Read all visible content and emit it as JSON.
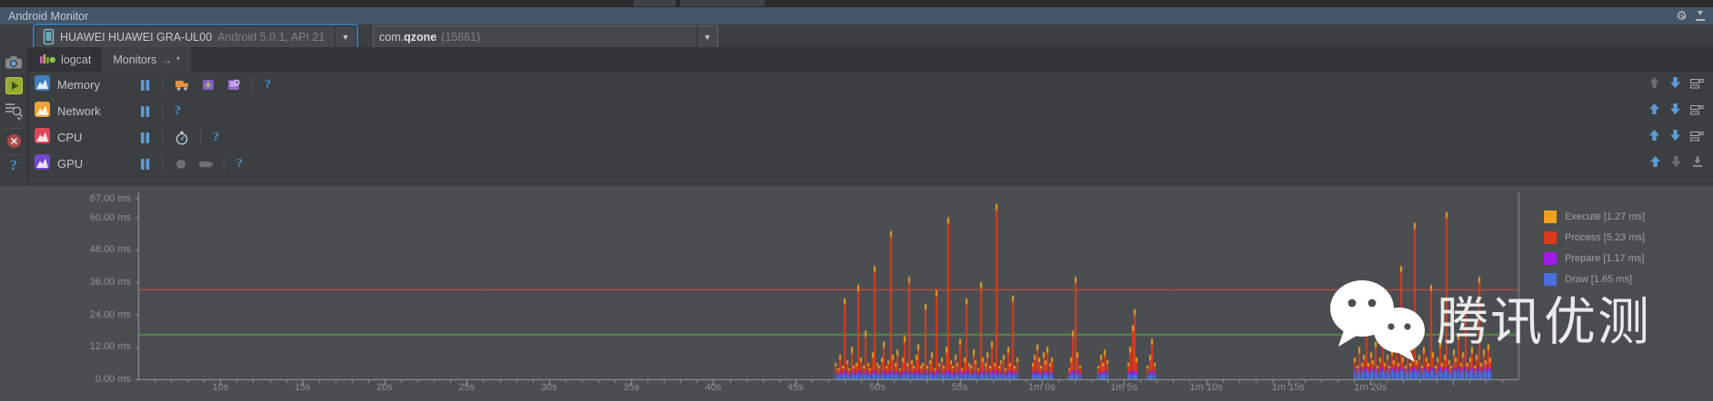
{
  "title_bar": {
    "title": "Android Monitor"
  },
  "toolbar": {
    "device": {
      "name": "HUAWEI HUAWEI GRA-UL00",
      "details": "Android 5.0.1, API 21"
    },
    "process": {
      "prefix": "com.",
      "name": "qzone",
      "pid": "(15861)"
    }
  },
  "tabs": [
    {
      "label": "logcat",
      "selected": false
    },
    {
      "label": "Monitors",
      "selected": true,
      "suffix": "→",
      "star": "*"
    }
  ],
  "monitors": [
    {
      "label": "Memory",
      "icon_color": "#3f7fc1",
      "tools": [
        "pause",
        "sep",
        "gc-truck",
        "heap-dump",
        "alloc-tracker",
        "sep",
        "help"
      ],
      "right": {
        "up": false,
        "down": true,
        "last": "restore"
      }
    },
    {
      "label": "Network",
      "icon_color": "#f0a232",
      "tools": [
        "pause",
        "sep",
        "help"
      ],
      "right": {
        "up": true,
        "down": true,
        "last": "restore"
      }
    },
    {
      "label": "CPU",
      "icon_color": "#e0495a",
      "tools": [
        "pause",
        "sep",
        "stopwatch",
        "sep",
        "help"
      ],
      "right": {
        "up": true,
        "down": true,
        "last": "restore"
      }
    },
    {
      "label": "GPU",
      "icon_color": "#7148ce",
      "tools": [
        "pause",
        "sep",
        "record-circle",
        "record-pill",
        "sep",
        "help-dim"
      ],
      "right": {
        "up": true,
        "down": false,
        "last": "minimize"
      }
    }
  ],
  "chart_data": {
    "type": "area",
    "stacked": true,
    "title": "GPU rendering time per frame (ms)",
    "ylabel": "ms",
    "ylim": [
      0,
      67
    ],
    "y_ticks": [
      {
        "v": 0,
        "label": "0.00 ms"
      },
      {
        "v": 12,
        "label": "12.00 ms"
      },
      {
        "v": 24,
        "label": "24.00 ms"
      },
      {
        "v": 36,
        "label": "36.00 ms"
      },
      {
        "v": 48,
        "label": "48.00 ms"
      },
      {
        "v": 60,
        "label": "60.00 ms"
      },
      {
        "v": 67,
        "label": "67.00 ms"
      }
    ],
    "x_ticks": [
      {
        "t": 10,
        "label": "10s"
      },
      {
        "t": 15,
        "label": "15s"
      },
      {
        "t": 20,
        "label": "20s"
      },
      {
        "t": 25,
        "label": "25s"
      },
      {
        "t": 30,
        "label": "30s"
      },
      {
        "t": 35,
        "label": "35s"
      },
      {
        "t": 40,
        "label": "40s"
      },
      {
        "t": 45,
        "label": "45s"
      },
      {
        "t": 50,
        "label": "50s"
      },
      {
        "t": 55,
        "label": "55s"
      },
      {
        "t": 60,
        "label": "1m 0s"
      },
      {
        "t": 65,
        "label": "1m 5s"
      },
      {
        "t": 70,
        "label": "1m 10s"
      },
      {
        "t": 75,
        "label": "1m 15s"
      },
      {
        "t": 80,
        "label": "1m 20s"
      }
    ],
    "guide_lines": [
      {
        "value_ms": 33.33,
        "color": "#e4483b"
      },
      {
        "value_ms": 16.67,
        "color": "#68be4e"
      }
    ],
    "legend": [
      {
        "label": "Execute [1.27 ms]",
        "color": "#eda120"
      },
      {
        "label": "Process [5.23 ms]",
        "color": "#dc3a1c"
      },
      {
        "label": "Prepare [1.17 ms]",
        "color": "#9e1ee8"
      },
      {
        "label": "Draw [1.65 ms]",
        "color": "#4a6edc"
      }
    ],
    "series_colors": {
      "draw": "#4a6edc",
      "prepare": "#9e1ee8",
      "process": "#dc3a1c",
      "execute": "#eda120"
    },
    "bursts": [
      {
        "start": 47.4,
        "step": 0.14,
        "draw_frac": 0.3,
        "totals": [
          6,
          4,
          9,
          5,
          30,
          7,
          4,
          12,
          5,
          6,
          35,
          8,
          5,
          18,
          6,
          4,
          10,
          42,
          6,
          5,
          8,
          14,
          5,
          7,
          55,
          9,
          6,
          11,
          4,
          8,
          16,
          6,
          38,
          7,
          5,
          9,
          13,
          5,
          6,
          28,
          5,
          7,
          10,
          4,
          33,
          6,
          8,
          5,
          12,
          60,
          7,
          5,
          9,
          6,
          15,
          4,
          8,
          30,
          6,
          5,
          11,
          7,
          4,
          36,
          8,
          6,
          10,
          5,
          14,
          6,
          65,
          5,
          7,
          9,
          4,
          12,
          6,
          31,
          5,
          8
        ]
      },
      {
        "start": 59.4,
        "step": 0.13,
        "draw_frac": 0.3,
        "totals": [
          6,
          9,
          13,
          8,
          5,
          10,
          7,
          12,
          6,
          8
        ]
      },
      {
        "start": 61.6,
        "step": 0.13,
        "draw_frac": 0.3,
        "totals": [
          4,
          8,
          18,
          38,
          10,
          5
        ]
      },
      {
        "start": 63.4,
        "step": 0.13,
        "draw_frac": 0.3,
        "totals": [
          5,
          9,
          6,
          11,
          7
        ]
      },
      {
        "start": 65.2,
        "step": 0.13,
        "draw_frac": 0.3,
        "totals": [
          6,
          12,
          20,
          26,
          8
        ]
      },
      {
        "start": 66.4,
        "step": 0.13,
        "draw_frac": 0.3,
        "totals": [
          5,
          9,
          15,
          6
        ]
      },
      {
        "start": 79.0,
        "step": 0.14,
        "draw_frac": 0.38,
        "totals": [
          8,
          5,
          12,
          6,
          9,
          25,
          6,
          10,
          7,
          14,
          5,
          8,
          31,
          6,
          9,
          5,
          11,
          7,
          16,
          6,
          42,
          8,
          5,
          10,
          6,
          13,
          58,
          7,
          9,
          5,
          12,
          8,
          6,
          35,
          10,
          5,
          8,
          14,
          6,
          9,
          62,
          7,
          5,
          11,
          8,
          17,
          6,
          10,
          28,
          6,
          8,
          12,
          5,
          9,
          38,
          6,
          11,
          7,
          13,
          8
        ]
      }
    ]
  },
  "watermark": {
    "text": "腾讯优测"
  }
}
